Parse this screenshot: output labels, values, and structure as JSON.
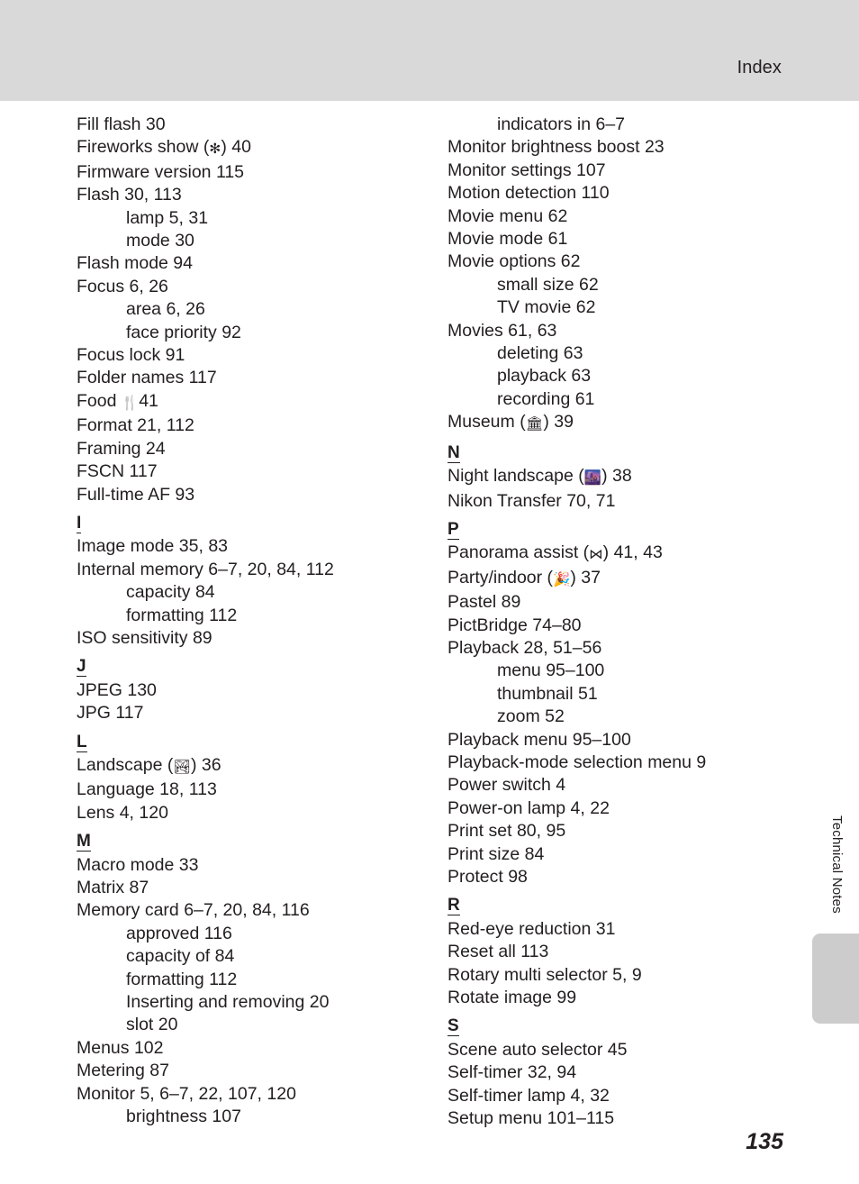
{
  "header": {
    "title": "Index"
  },
  "side": {
    "vertical_label": "Technical Notes"
  },
  "footer": {
    "page_number": "135"
  },
  "columns": {
    "left": [
      {
        "type": "entry",
        "text": "Fill flash 30"
      },
      {
        "type": "entry",
        "text": "Fireworks show (",
        "icon": "fireworks-icon",
        "glyph": "✻",
        "text_after": ") 40"
      },
      {
        "type": "entry",
        "text": "Firmware version 115"
      },
      {
        "type": "entry",
        "text": "Flash 30, 113"
      },
      {
        "type": "sub",
        "text": "lamp 5, 31"
      },
      {
        "type": "sub",
        "text": "mode 30"
      },
      {
        "type": "entry",
        "text": "Flash mode 94"
      },
      {
        "type": "entry",
        "text": "Focus 6, 26"
      },
      {
        "type": "sub",
        "text": "area 6, 26"
      },
      {
        "type": "sub",
        "text": "face priority 92"
      },
      {
        "type": "entry",
        "text": "Focus lock 91"
      },
      {
        "type": "entry",
        "text": "Folder names 117"
      },
      {
        "type": "entry",
        "text": "Food ",
        "icon": "fork-knife-icon",
        "glyph": "🍴",
        "text_after": "41"
      },
      {
        "type": "entry",
        "text": "Format 21, 112"
      },
      {
        "type": "entry",
        "text": "Framing 24"
      },
      {
        "type": "entry",
        "text": "FSCN 117"
      },
      {
        "type": "entry",
        "text": "Full-time AF 93"
      },
      {
        "type": "head",
        "text": "I"
      },
      {
        "type": "entry",
        "text": "Image mode 35, 83"
      },
      {
        "type": "entry",
        "text": "Internal memory 6–7, 20, 84, 112"
      },
      {
        "type": "sub",
        "text": "capacity 84"
      },
      {
        "type": "sub",
        "text": "formatting 112"
      },
      {
        "type": "entry",
        "text": "ISO sensitivity 89"
      },
      {
        "type": "head",
        "text": "J"
      },
      {
        "type": "entry",
        "text": "JPEG 130"
      },
      {
        "type": "entry",
        "text": "JPG 117"
      },
      {
        "type": "head",
        "text": "L"
      },
      {
        "type": "entry",
        "text": "Landscape (",
        "icon": "landscape-icon",
        "glyph": "🏞",
        "text_after": ") 36"
      },
      {
        "type": "entry",
        "text": "Language 18, 113"
      },
      {
        "type": "entry",
        "text": "Lens 4, 120"
      },
      {
        "type": "head",
        "text": "M"
      },
      {
        "type": "entry",
        "text": "Macro mode 33"
      },
      {
        "type": "entry",
        "text": "Matrix 87"
      },
      {
        "type": "entry",
        "text": "Memory card 6–7, 20, 84, 116"
      },
      {
        "type": "sub",
        "text": "approved 116"
      },
      {
        "type": "sub",
        "text": "capacity of 84"
      },
      {
        "type": "sub",
        "text": "formatting 112"
      },
      {
        "type": "sub",
        "text": "Inserting and removing 20"
      },
      {
        "type": "sub",
        "text": "slot 20"
      },
      {
        "type": "entry",
        "text": "Menus 102"
      },
      {
        "type": "entry",
        "text": "Metering 87"
      },
      {
        "type": "entry",
        "text": "Monitor 5, 6–7, 22, 107, 120"
      },
      {
        "type": "sub",
        "text": "brightness 107"
      }
    ],
    "right": [
      {
        "type": "sub",
        "text": "indicators in 6–7"
      },
      {
        "type": "entry",
        "text": "Monitor brightness boost 23"
      },
      {
        "type": "entry",
        "text": "Monitor settings 107"
      },
      {
        "type": "entry",
        "text": "Motion detection 110"
      },
      {
        "type": "entry",
        "text": "Movie menu 62"
      },
      {
        "type": "entry",
        "text": "Movie mode 61"
      },
      {
        "type": "entry",
        "text": "Movie options 62"
      },
      {
        "type": "sub",
        "text": "small size 62"
      },
      {
        "type": "sub",
        "text": "TV movie 62"
      },
      {
        "type": "entry",
        "text": "Movies 61, 63"
      },
      {
        "type": "sub",
        "text": "deleting 63"
      },
      {
        "type": "sub",
        "text": "playback 63"
      },
      {
        "type": "sub",
        "text": "recording 61"
      },
      {
        "type": "entry",
        "text": "Museum (",
        "icon": "museum-icon",
        "glyph": "🏛",
        "text_after": ") 39"
      },
      {
        "type": "head",
        "text": "N"
      },
      {
        "type": "entry",
        "text": "Night landscape (",
        "icon": "night-landscape-icon",
        "glyph": "🌆",
        "text_after": ") 38"
      },
      {
        "type": "entry",
        "text": "Nikon Transfer 70, 71"
      },
      {
        "type": "head",
        "text": "P"
      },
      {
        "type": "entry",
        "text": "Panorama assist (",
        "icon": "panorama-icon",
        "glyph": "⋈",
        "text_after": ") 41, 43"
      },
      {
        "type": "entry",
        "text": "Party/indoor (",
        "icon": "party-popper-icon",
        "glyph": "🎉",
        "text_after": ") 37"
      },
      {
        "type": "entry",
        "text": "Pastel 89"
      },
      {
        "type": "entry",
        "text": "PictBridge 74–80"
      },
      {
        "type": "entry",
        "text": "Playback 28, 51–56"
      },
      {
        "type": "sub",
        "text": "menu 95–100"
      },
      {
        "type": "sub",
        "text": "thumbnail 51"
      },
      {
        "type": "sub",
        "text": "zoom 52"
      },
      {
        "type": "entry",
        "text": "Playback menu 95–100"
      },
      {
        "type": "entry",
        "text": "Playback-mode selection menu 9"
      },
      {
        "type": "entry",
        "text": "Power switch 4"
      },
      {
        "type": "entry",
        "text": "Power-on lamp 4, 22"
      },
      {
        "type": "entry",
        "text": "Print set 80, 95"
      },
      {
        "type": "entry",
        "text": "Print size 84"
      },
      {
        "type": "entry",
        "text": "Protect 98"
      },
      {
        "type": "head",
        "text": "R"
      },
      {
        "type": "entry",
        "text": "Red-eye reduction 31"
      },
      {
        "type": "entry",
        "text": "Reset all 113"
      },
      {
        "type": "entry",
        "text": "Rotary multi selector 5, 9"
      },
      {
        "type": "entry",
        "text": "Rotate image 99"
      },
      {
        "type": "head",
        "text": "S"
      },
      {
        "type": "entry",
        "text": "Scene auto selector 45"
      },
      {
        "type": "entry",
        "text": "Self-timer 32, 94"
      },
      {
        "type": "entry",
        "text": "Self-timer lamp 4, 32"
      },
      {
        "type": "entry",
        "text": "Setup menu 101–115"
      }
    ]
  },
  "colors": {
    "header_band": "#d9d9d9",
    "side_tab": "#cccccc",
    "text": "#231f20"
  }
}
